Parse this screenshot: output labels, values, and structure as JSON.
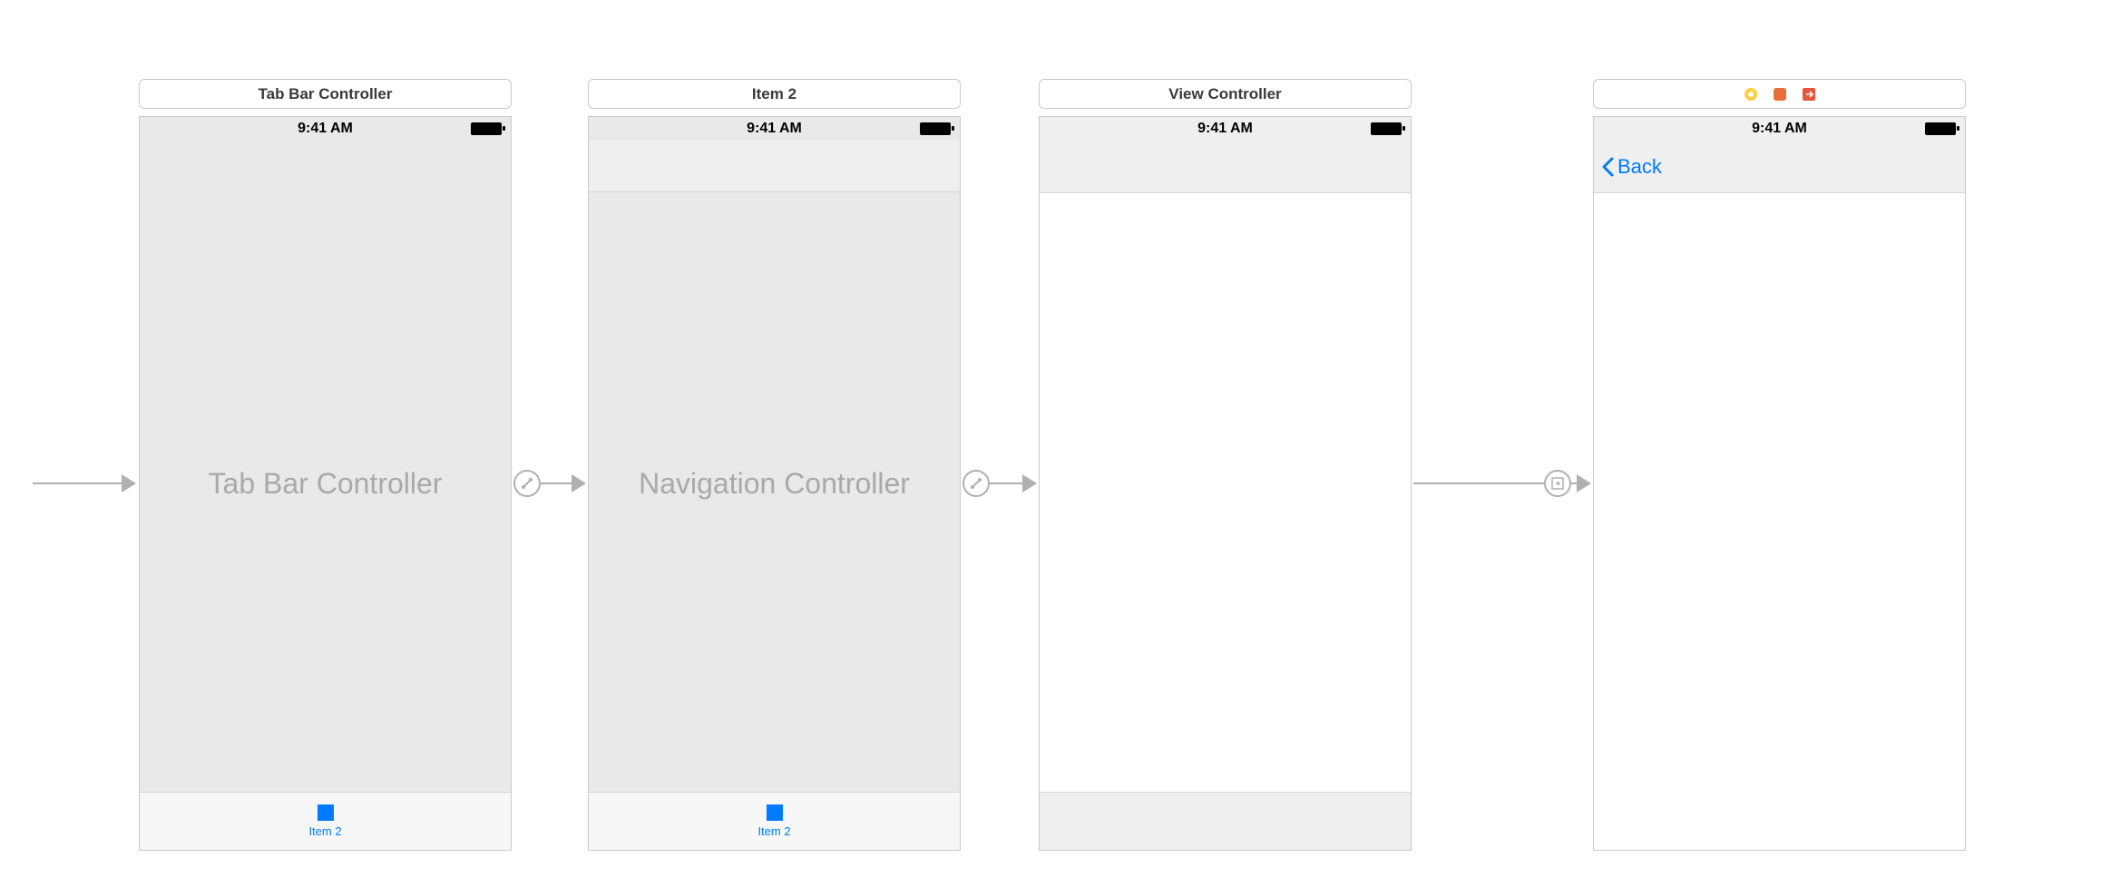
{
  "status_time": "9:41 AM",
  "scenes": {
    "tabbar": {
      "label": "Tab Bar Controller",
      "center_text": "Tab Bar Controller",
      "tab_item_label": "Item 2"
    },
    "nav": {
      "label": "Item 2",
      "center_text": "Navigation Controller",
      "tab_item_label": "Item 2"
    },
    "view": {
      "label": "View Controller"
    },
    "detail": {
      "back_label": "Back"
    }
  }
}
